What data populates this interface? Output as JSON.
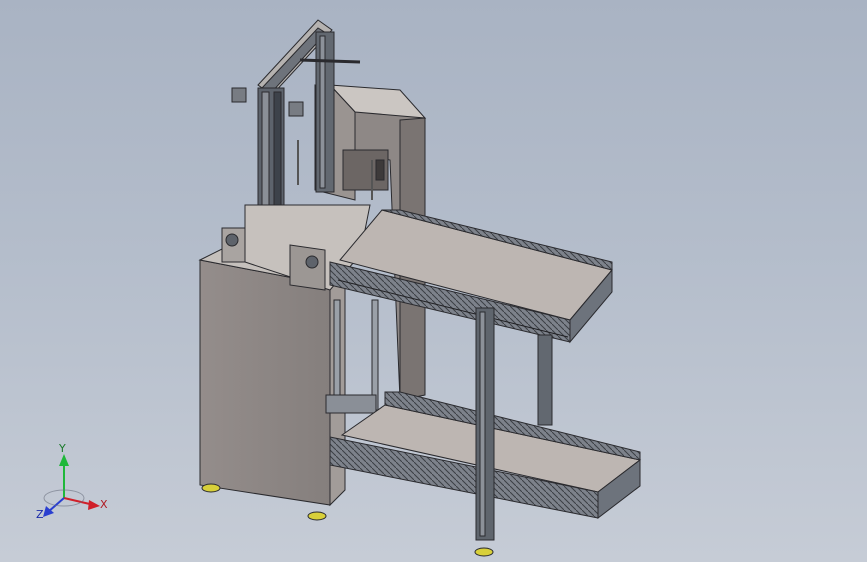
{
  "triad": {
    "x_label": "X",
    "y_label": "Y",
    "z_label": "Z",
    "x_color": "#d0202a",
    "y_color": "#1fb83a",
    "z_color": "#2a3fd0"
  },
  "colors": {
    "background_top": "#a9b3c3",
    "background_bottom": "#c6ccd6",
    "panel_front": "#8f8886",
    "panel_side": "#a39d9a",
    "panel_top": "#c9c4c0",
    "belt": "#bdb6b2",
    "rail": "#6f7580",
    "edge": "#2a2a2e"
  }
}
